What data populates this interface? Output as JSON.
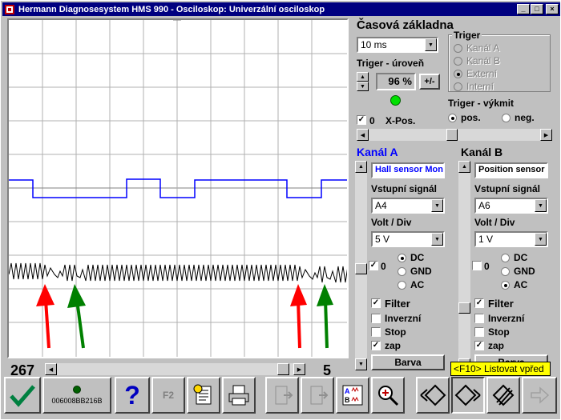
{
  "window": {
    "title": "Hermann Diagnosesystem HMS 990 - Osciloskop: Univerzální osciloskop"
  },
  "titlebar_buttons": {
    "minimize": "_",
    "maximize": "□",
    "close": "×"
  },
  "timebase": {
    "title": "Časová základna",
    "value": "10 ms",
    "trigger_level_label": "Triger - úroveň",
    "trigger_level_value": "96 %",
    "plusminus_label": "+/-",
    "indicator_color": "#00e000",
    "xpos_check": "0",
    "xpos_label": "X-Pos."
  },
  "trigger": {
    "title": "Triger",
    "options": [
      "Kanál A",
      "Kanál B",
      "Externí",
      "Interní"
    ],
    "selected": "Externí",
    "slope_title": "Triger - výkmit",
    "slope_options": [
      "pos.",
      "neg."
    ],
    "slope_selected": "pos."
  },
  "channel_a": {
    "title": "Kanál A",
    "name_field": "Hall sensor Mon",
    "input_label": "Vstupní signál",
    "input_value": "A4",
    "volt_label": "Volt / Div",
    "volt_value": "5 V",
    "zero_check": "0",
    "coupling": [
      "DC",
      "GND",
      "AC"
    ],
    "coupling_selected": "DC",
    "filter_label": "Filter",
    "inverse_label": "Inverzní",
    "stop_label": "Stop",
    "on_label": "zap",
    "color_button": "Barva",
    "color": "#0000ff"
  },
  "channel_b": {
    "title": "Kanál B",
    "name_field": "Position sensor",
    "input_label": "Vstupní signál",
    "input_value": "A6",
    "volt_label": "Volt / Div",
    "volt_value": "1 V",
    "zero_check": "0",
    "coupling": [
      "DC",
      "GND",
      "AC"
    ],
    "coupling_selected": "AC",
    "filter_label": "Filter",
    "inverse_label": "Inverzní",
    "stop_label": "Stop",
    "on_label": "zap",
    "color_button": "Barva",
    "color": "#000000"
  },
  "scope": {
    "left_counter": "267",
    "right_counter": "5"
  },
  "tooltip": {
    "text": "<F10> Listovat vpřed"
  },
  "toolbar": {
    "device_id": "006008BB216B",
    "f2_label": "F2",
    "help_label": "?"
  },
  "colors": {
    "arrow_red": "#ff0000",
    "arrow_green": "#008000",
    "title_bg": "#000080"
  }
}
